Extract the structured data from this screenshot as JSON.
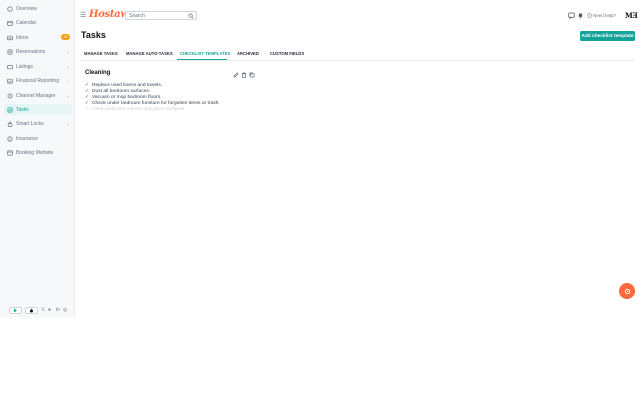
{
  "sidebar": {
    "items": [
      {
        "label": "Overview",
        "icon": "overview-icon"
      },
      {
        "label": "Calendar",
        "icon": "calendar-icon"
      },
      {
        "label": "Inbox",
        "icon": "inbox-icon",
        "badge": "28"
      },
      {
        "label": "Reservations",
        "icon": "reservations-icon",
        "chevron": true
      },
      {
        "label": "Listings",
        "icon": "listings-icon",
        "chevron": true
      },
      {
        "label": "Financial Reporting",
        "icon": "financial-icon",
        "chevron": true
      },
      {
        "label": "Channel Manager",
        "icon": "channel-icon",
        "chevron": true
      },
      {
        "label": "Tasks",
        "icon": "tasks-icon",
        "active": true
      },
      {
        "label": "Smart Locks",
        "icon": "lock-icon",
        "chevron": true
      },
      {
        "label": "Insurance",
        "icon": "insurance-icon"
      },
      {
        "label": "Booking Website",
        "icon": "website-icon"
      }
    ]
  },
  "header": {
    "logo": "Hostaway",
    "search_placeholder": "Search",
    "help_label": "Need help?",
    "avatar_text": "MƎ"
  },
  "page": {
    "title": "Tasks",
    "add_button": "Add checklist template"
  },
  "tabs": [
    {
      "label": "MANAGE TASKS"
    },
    {
      "label": "MANAGE AUTO-TASKS"
    },
    {
      "label": "CHECKLIST TEMPLATES",
      "active": true
    },
    {
      "label": "ARCHIVED"
    },
    {
      "label": "CUSTOM FIELDS"
    }
  ],
  "template": {
    "title": "Cleaning",
    "items": [
      "Replace used linens and towels.",
      "Dust all bedroom surfaces.",
      "Vacuum or mop bedroom floors.",
      "Check under bedroom furniture for forgotten items or trash.",
      "Clean bedroom mirrors and glass surfaces."
    ]
  },
  "colors": {
    "accent": "#14a39a",
    "brand": "#ff6a3d",
    "badge": "#f59e0b"
  }
}
